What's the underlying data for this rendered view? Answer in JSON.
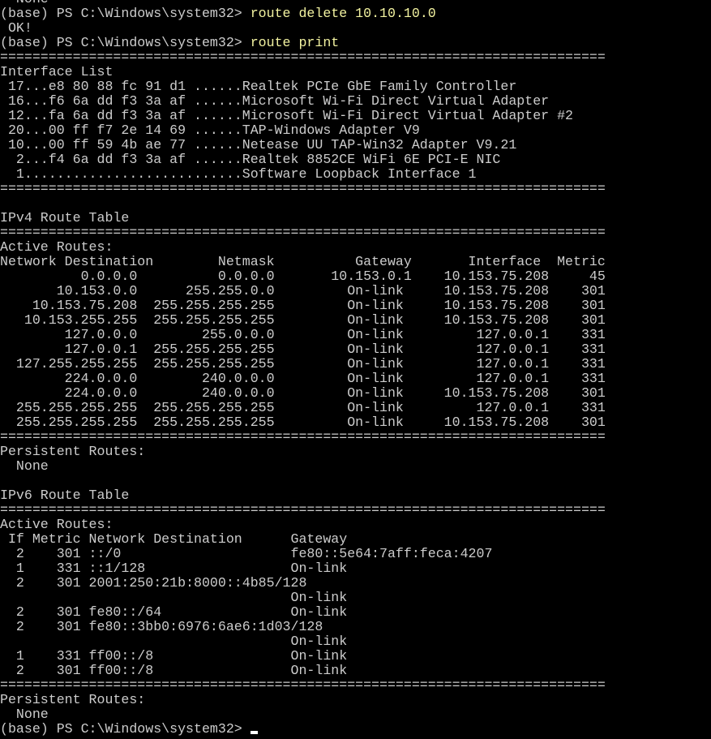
{
  "terminal": {
    "lines": [
      {
        "text": "  None"
      },
      {
        "prompt": "(base) PS C:\\Windows\\system32> ",
        "command": "route delete 10.10.10.0"
      },
      {
        "text": " OK!"
      },
      {
        "prompt": "(base) PS C:\\Windows\\system32> ",
        "command": "route print"
      },
      {
        "text": "==========================================================================="
      },
      {
        "text": "Interface List"
      },
      {
        "text": " 17...e8 80 88 fc 91 d1 ......Realtek PCIe GbE Family Controller"
      },
      {
        "text": " 16...f6 6a dd f3 3a af ......Microsoft Wi-Fi Direct Virtual Adapter"
      },
      {
        "text": " 12...fa 6a dd f3 3a af ......Microsoft Wi-Fi Direct Virtual Adapter #2"
      },
      {
        "text": " 20...00 ff f7 2e 14 69 ......TAP-Windows Adapter V9"
      },
      {
        "text": " 10...00 ff 59 4b ae 77 ......Netease UU TAP-Win32 Adapter V9.21"
      },
      {
        "text": "  2...f4 6a dd f3 3a af ......Realtek 8852CE WiFi 6E PCI-E NIC"
      },
      {
        "text": "  1...........................Software Loopback Interface 1"
      },
      {
        "text": "==========================================================================="
      },
      {
        "text": ""
      },
      {
        "text": "IPv4 Route Table"
      },
      {
        "text": "==========================================================================="
      },
      {
        "text": "Active Routes:"
      },
      {
        "text": "Network Destination        Netmask          Gateway       Interface  Metric"
      },
      {
        "text": "          0.0.0.0          0.0.0.0       10.153.0.1    10.153.75.208     45"
      },
      {
        "text": "       10.153.0.0      255.255.0.0         On-link     10.153.75.208    301"
      },
      {
        "text": "    10.153.75.208  255.255.255.255         On-link     10.153.75.208    301"
      },
      {
        "text": "   10.153.255.255  255.255.255.255         On-link     10.153.75.208    301"
      },
      {
        "text": "        127.0.0.0        255.0.0.0         On-link         127.0.0.1    331"
      },
      {
        "text": "        127.0.0.1  255.255.255.255         On-link         127.0.0.1    331"
      },
      {
        "text": "  127.255.255.255  255.255.255.255         On-link         127.0.0.1    331"
      },
      {
        "text": "        224.0.0.0        240.0.0.0         On-link         127.0.0.1    331"
      },
      {
        "text": "        224.0.0.0        240.0.0.0         On-link     10.153.75.208    301"
      },
      {
        "text": "  255.255.255.255  255.255.255.255         On-link         127.0.0.1    331"
      },
      {
        "text": "  255.255.255.255  255.255.255.255         On-link     10.153.75.208    301"
      },
      {
        "text": "==========================================================================="
      },
      {
        "text": "Persistent Routes:"
      },
      {
        "text": "  None"
      },
      {
        "text": ""
      },
      {
        "text": "IPv6 Route Table"
      },
      {
        "text": "==========================================================================="
      },
      {
        "text": "Active Routes:"
      },
      {
        "text": " If Metric Network Destination      Gateway"
      },
      {
        "text": "  2    301 ::/0                     fe80::5e64:7aff:feca:4207"
      },
      {
        "text": "  1    331 ::1/128                  On-link"
      },
      {
        "text": "  2    301 2001:250:21b:8000::4b85/128"
      },
      {
        "text": "                                    On-link"
      },
      {
        "text": "  2    301 fe80::/64                On-link"
      },
      {
        "text": "  2    301 fe80::3bb0:6976:6ae6:1d03/128"
      },
      {
        "text": "                                    On-link"
      },
      {
        "text": "  1    331 ff00::/8                 On-link"
      },
      {
        "text": "  2    301 ff00::/8                 On-link"
      },
      {
        "text": "==========================================================================="
      },
      {
        "text": "Persistent Routes:"
      },
      {
        "text": "  None"
      },
      {
        "prompt": "(base) PS C:\\Windows\\system32> ",
        "command": "",
        "cursor": true
      }
    ]
  },
  "colors": {
    "background": "#000000",
    "text": "#cccccc",
    "command": "#f2f2a0",
    "cursor": "#ffffff"
  }
}
